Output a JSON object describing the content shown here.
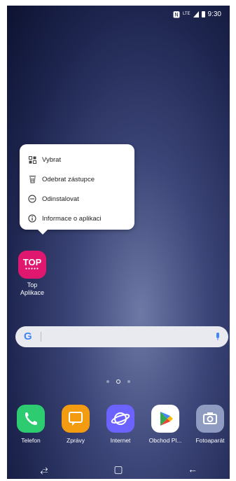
{
  "status_bar": {
    "nfc_icon": "nfc-icon",
    "network_label": "LTE",
    "time": "9:30"
  },
  "context_menu": {
    "items": [
      {
        "label": "Vybrat",
        "icon": "select-grid-icon"
      },
      {
        "label": "Odebrat zástupce",
        "icon": "trash-icon"
      },
      {
        "label": "Odinstalovat",
        "icon": "minus-circle-icon"
      },
      {
        "label": "Informace o aplikaci",
        "icon": "info-icon"
      }
    ]
  },
  "home_app": {
    "icon_text": "TOP",
    "icon_dots": "●●●●●",
    "label_line1": "Top",
    "label_line2": "Aplikace",
    "color": "#e0176e"
  },
  "search": {
    "google_letter": "G"
  },
  "dock": [
    {
      "label": "Telefon",
      "icon": "phone-icon",
      "color": "#2ecc71"
    },
    {
      "label": "Zprávy",
      "icon": "message-icon",
      "color": "#f39c12"
    },
    {
      "label": "Internet",
      "icon": "internet-icon",
      "color": "#6c63ff"
    },
    {
      "label": "Obchod Pl...",
      "icon": "play-store-icon",
      "color": "#ffffff"
    },
    {
      "label": "Fotoaparát",
      "icon": "camera-icon",
      "color": "#8f9bc0"
    }
  ],
  "nav": {
    "recents": "⥄",
    "home": "▢",
    "back": "←"
  }
}
